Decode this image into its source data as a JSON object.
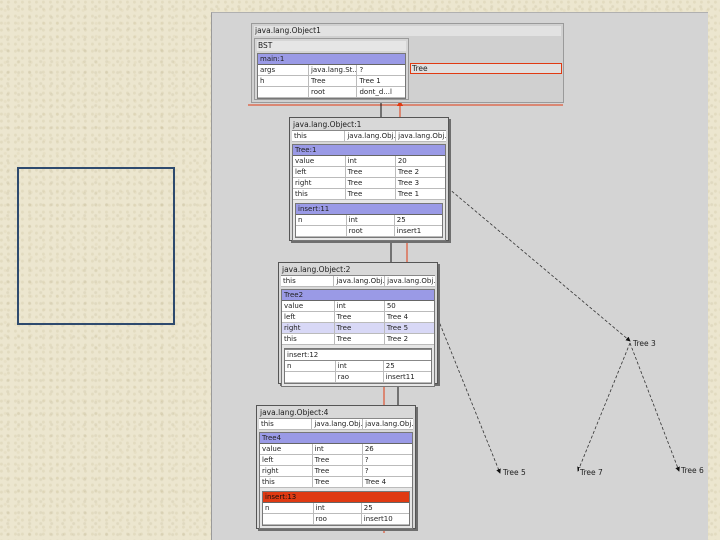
{
  "root_frame": {
    "title": "java.lang.Object1"
  },
  "bst_frame": {
    "title": "BST",
    "main": {
      "title": "main:1",
      "rows": [
        [
          "args",
          "java.lang.St... ?",
          "?"
        ],
        [
          "h",
          "Tree",
          "Tree 1"
        ],
        [
          "",
          "root",
          "dont_d...l"
        ]
      ]
    }
  },
  "tree_box": {
    "label": "Tree"
  },
  "obj1": {
    "title": "java.lang.Object:1",
    "head_row": [
      "this",
      "java.lang.Obj...",
      "java.lang.Obj..."
    ],
    "tree": {
      "title": "Tree:1",
      "rows": [
        [
          "value",
          "int",
          "20"
        ],
        [
          "left",
          "Tree",
          "Tree 2"
        ],
        [
          "right",
          "Tree",
          "Tree 3"
        ],
        [
          "this",
          "Tree",
          "Tree 1"
        ]
      ]
    },
    "insert": {
      "title": "insert:11",
      "rows": [
        [
          "n",
          "int",
          "25"
        ],
        [
          "",
          "root",
          "insert1"
        ]
      ]
    }
  },
  "obj2": {
    "title": "java.lang.Object:2",
    "head_row": [
      "this",
      "java.lang.Obj...",
      "java.lang.Obj..."
    ],
    "tree": {
      "title": "Tree2",
      "rows": [
        [
          "value",
          "int",
          "50"
        ],
        [
          "left",
          "Tree",
          "Tree 4"
        ],
        [
          "right",
          "Tree",
          "Tree 5"
        ],
        [
          "this",
          "Tree",
          "Tree 2"
        ]
      ]
    },
    "insert": {
      "title": "insert:12",
      "rows": [
        [
          "n",
          "int",
          "25"
        ],
        [
          "",
          "rao",
          "insert11"
        ]
      ]
    }
  },
  "obj4": {
    "title": "java.lang.Object:4",
    "head_row": [
      "this",
      "java.lang.Obj...",
      "java.lang.Obj..."
    ],
    "tree": {
      "title": "Tree4",
      "rows": [
        [
          "value",
          "int",
          "26"
        ],
        [
          "left",
          "Tree",
          "?"
        ],
        [
          "right",
          "Tree",
          "?"
        ],
        [
          "this",
          "Tree",
          "Tree 4"
        ]
      ]
    },
    "insert": {
      "title": "insert:13",
      "rows": [
        [
          "n",
          "int",
          "25"
        ],
        [
          "",
          "roo",
          "insert10"
        ]
      ]
    }
  },
  "nodes": {
    "tree3": "Tree 3",
    "tree5": "Tree 5",
    "tree7": "Tree 7",
    "tree6": "Tree 6"
  },
  "colors": {
    "canvas": "#d4d4d4",
    "header": "#9a9ae6",
    "active_frame": "#e03a12",
    "pointer_red": "#e03a12",
    "outline": "#2e4a6e"
  }
}
